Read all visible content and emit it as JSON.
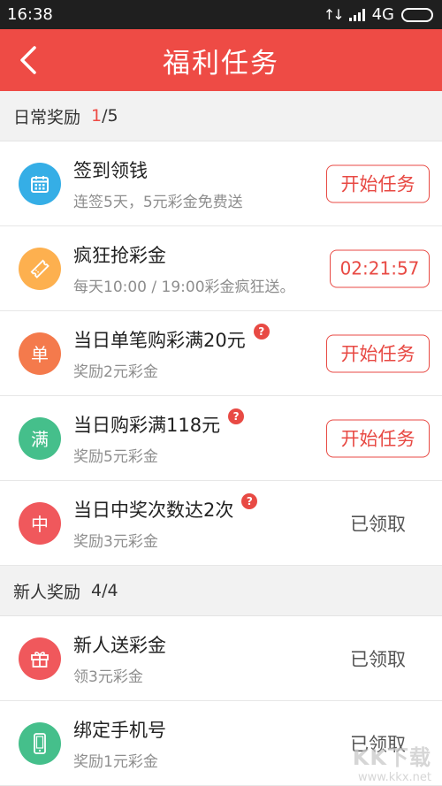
{
  "status_bar": {
    "time": "16:38",
    "network": "4G"
  },
  "header": {
    "title": "福利任务"
  },
  "sections": [
    {
      "title": "日常奖励",
      "count_done": "1",
      "count_total": "/5",
      "tasks": [
        {
          "title": "签到领钱",
          "subtitle": "连签5天，5元彩金免费送",
          "action": "开始任务",
          "icon_text": ""
        },
        {
          "title": "疯狂抢彩金",
          "subtitle": "每天10:00 / 19:00彩金疯狂送。",
          "action": "02:21:57",
          "icon_text": ""
        },
        {
          "title": "当日单笔购彩满20元",
          "subtitle": "奖励2元彩金",
          "action": "开始任务",
          "icon_text": "单"
        },
        {
          "title": "当日购彩满118元",
          "subtitle": "奖励5元彩金",
          "action": "开始任务",
          "icon_text": "满"
        },
        {
          "title": "当日中奖次数达2次",
          "subtitle": "奖励3元彩金",
          "action": "已领取",
          "icon_text": "中"
        }
      ]
    },
    {
      "title": "新人奖励",
      "count": "4/4",
      "tasks": [
        {
          "title": "新人送彩金",
          "subtitle": "领3元彩金",
          "action": "已领取"
        },
        {
          "title": "绑定手机号",
          "subtitle": "奖励1元彩金",
          "action": "已领取"
        }
      ]
    }
  ],
  "watermark": {
    "logo": "KK下载",
    "url": "www.kkx.net"
  },
  "colors": {
    "brand_red": "#ee4b45",
    "calendar_blue": "#35aee6",
    "ticket_orange": "#fdb04f",
    "dan_orange": "#f47a4c",
    "man_green": "#45bf8b",
    "zhong_red": "#f0585c",
    "gift_red": "#f0585c",
    "phone_green": "#45bf8b"
  },
  "icons": [
    "back-icon",
    "calendar-icon",
    "ticket-icon",
    "dan-icon",
    "man-icon",
    "zhong-icon",
    "gift-icon",
    "phone-icon",
    "help-icon"
  ]
}
